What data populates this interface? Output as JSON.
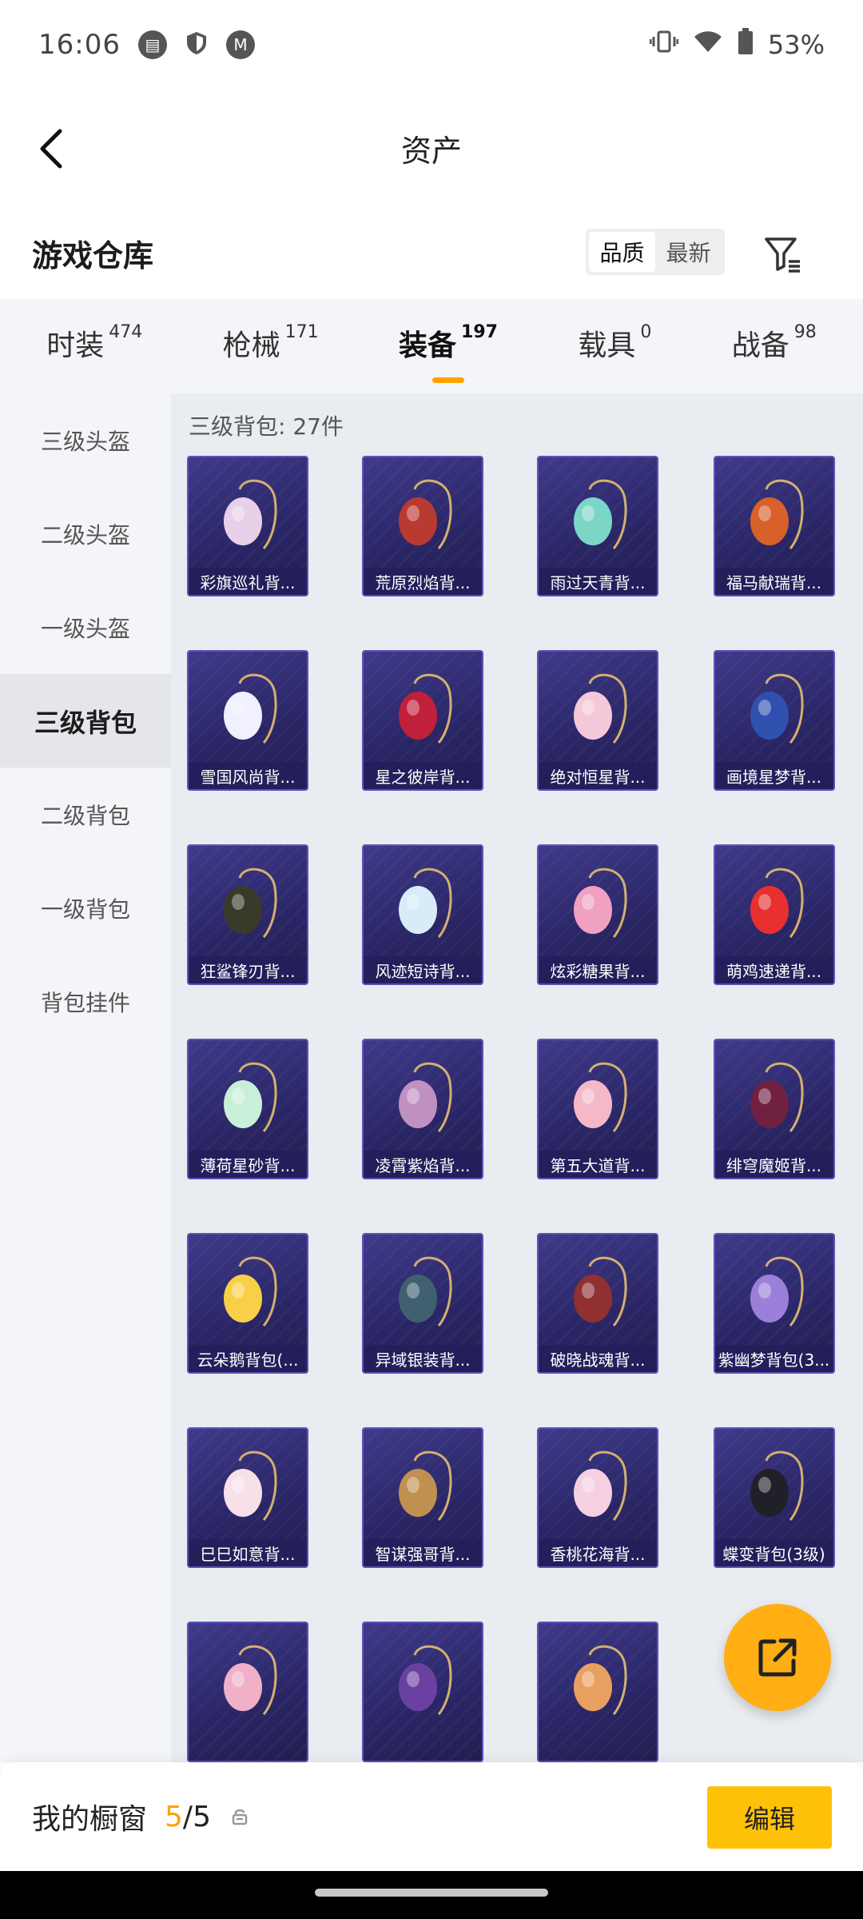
{
  "status_bar": {
    "time": "16:06",
    "battery": "53%"
  },
  "nav": {
    "title": "资产"
  },
  "warehouse": {
    "title": "游戏仓库",
    "sort_options": [
      "品质",
      "最新"
    ],
    "active_sort": "品质"
  },
  "tabs": [
    {
      "label": "时装",
      "count": "474"
    },
    {
      "label": "枪械",
      "count": "171"
    },
    {
      "label": "装备",
      "count": "197",
      "active": true
    },
    {
      "label": "载具",
      "count": "0"
    },
    {
      "label": "战备",
      "count": "98"
    }
  ],
  "sidebar": [
    {
      "label": "三级头盔"
    },
    {
      "label": "二级头盔"
    },
    {
      "label": "一级头盔"
    },
    {
      "label": "三级背包",
      "active": true
    },
    {
      "label": "二级背包"
    },
    {
      "label": "一级背包"
    },
    {
      "label": "背包挂件"
    }
  ],
  "content": {
    "title": "三级背包: 27件",
    "items": [
      {
        "label": "彩旗巡礼背...",
        "color": "#e8d0e8"
      },
      {
        "label": "荒原烈焰背...",
        "color": "#b83a30"
      },
      {
        "label": "雨过天青背...",
        "color": "#7cd6c8"
      },
      {
        "label": "福马献瑞背...",
        "color": "#d8602a"
      },
      {
        "label": "雪国风尚背...",
        "color": "#f0f0ff"
      },
      {
        "label": "星之彼岸背...",
        "color": "#c0203a"
      },
      {
        "label": "绝对恒星背...",
        "color": "#f4c8d8"
      },
      {
        "label": "画境星梦背...",
        "color": "#3050b0"
      },
      {
        "label": "狂鲨锋刃背...",
        "color": "#3a3a2a"
      },
      {
        "label": "风迹短诗背...",
        "color": "#d8ecf8"
      },
      {
        "label": "炫彩糖果背...",
        "color": "#f0a0c0"
      },
      {
        "label": "萌鸡速递背...",
        "color": "#e83030"
      },
      {
        "label": "薄荷星砂背...",
        "color": "#c8f0d8"
      },
      {
        "label": "凌霄紫焰背...",
        "color": "#c090c0"
      },
      {
        "label": "第五大道背...",
        "color": "#f4b8c8"
      },
      {
        "label": "绯穹魔姬背...",
        "color": "#702040"
      },
      {
        "label": "云朵鹅背包(...",
        "color": "#f8d048"
      },
      {
        "label": "异域银装背...",
        "color": "#406070"
      },
      {
        "label": "破晓战魂背...",
        "color": "#903030"
      },
      {
        "label": "紫幽梦背包(3...",
        "color": "#9a80d8"
      },
      {
        "label": "巳巳如意背...",
        "color": "#f8e0e8"
      },
      {
        "label": "智谋强哥背...",
        "color": "#c09050"
      },
      {
        "label": "香桃花海背...",
        "color": "#f4d0e0"
      },
      {
        "label": "蝶变背包(3级)",
        "color": "#202028"
      },
      {
        "label": "",
        "color": "#f0b0c8"
      },
      {
        "label": "",
        "color": "#6a40a0"
      },
      {
        "label": "",
        "color": "#e8a060"
      }
    ]
  },
  "bottom_bar": {
    "title": "我的橱窗",
    "current": "5",
    "separator": "/",
    "max": "5",
    "edit_label": "编辑"
  }
}
